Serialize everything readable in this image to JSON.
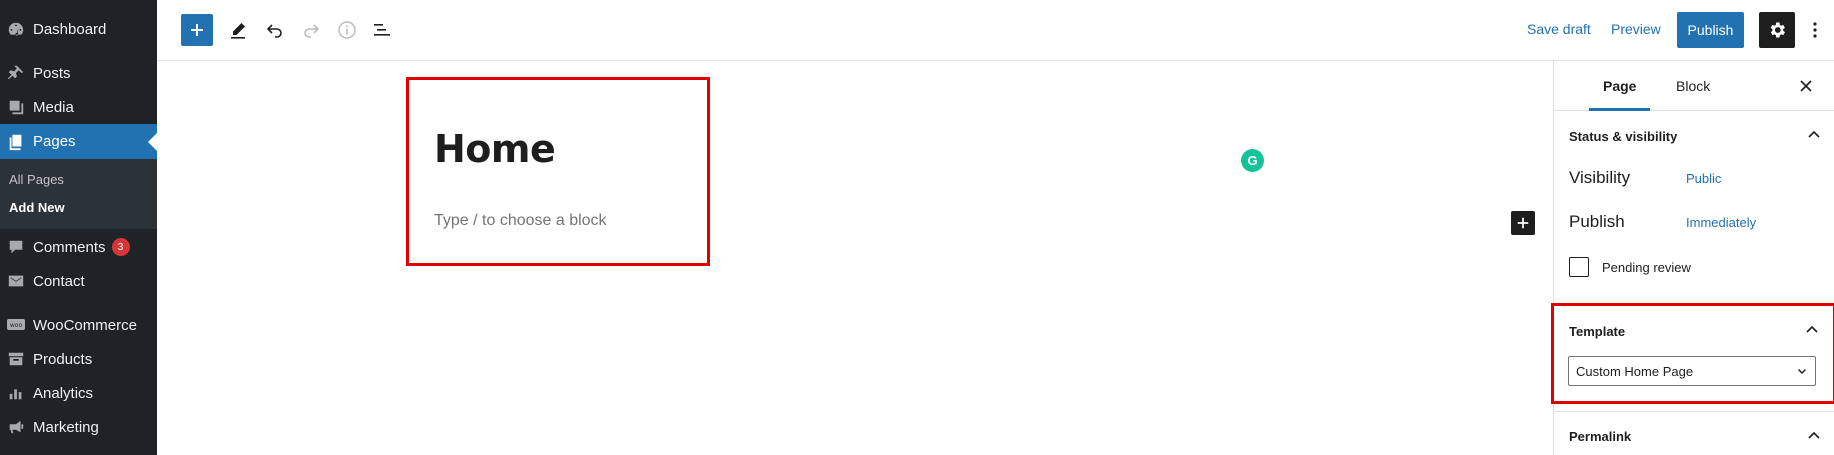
{
  "admin_menu": {
    "items": [
      {
        "id": "dashboard",
        "label": "Dashboard",
        "icon": "dashboard-icon"
      },
      {
        "id": "posts",
        "label": "Posts",
        "icon": "pin-icon"
      },
      {
        "id": "media",
        "label": "Media",
        "icon": "media-icon"
      },
      {
        "id": "pages",
        "label": "Pages",
        "icon": "pages-icon",
        "current": true
      },
      {
        "id": "comments",
        "label": "Comments",
        "icon": "comment-icon",
        "badge": "3"
      },
      {
        "id": "contact",
        "label": "Contact",
        "icon": "envelope-icon"
      },
      {
        "id": "woocommerce",
        "label": "WooCommerce",
        "icon": "woo-icon"
      },
      {
        "id": "products",
        "label": "Products",
        "icon": "archive-icon"
      },
      {
        "id": "analytics",
        "label": "Analytics",
        "icon": "bar-chart-icon"
      },
      {
        "id": "marketing",
        "label": "Marketing",
        "icon": "megaphone-icon"
      }
    ],
    "submenu": [
      {
        "label": "All Pages",
        "active": false
      },
      {
        "label": "Add New",
        "active": true
      }
    ]
  },
  "toolbar": {
    "save_draft": "Save draft",
    "preview": "Preview",
    "publish": "Publish"
  },
  "editor": {
    "title": "Home",
    "block_placeholder": "Type / to choose a block"
  },
  "settings": {
    "tabs": [
      "Page",
      "Block"
    ],
    "active_tab": "Page",
    "status_panel": {
      "title": "Status & visibility",
      "visibility_label": "Visibility",
      "visibility_value": "Public",
      "publish_label": "Publish",
      "publish_value": "Immediately",
      "pending_review": "Pending review"
    },
    "template_panel": {
      "title": "Template",
      "selected": "Custom Home Page"
    },
    "permalink_panel": {
      "title": "Permalink"
    }
  },
  "colors": {
    "admin_bg": "#1d2327",
    "accent": "#2271b1",
    "highlight_box": "#e00000",
    "grammarly": "#15c39a"
  }
}
